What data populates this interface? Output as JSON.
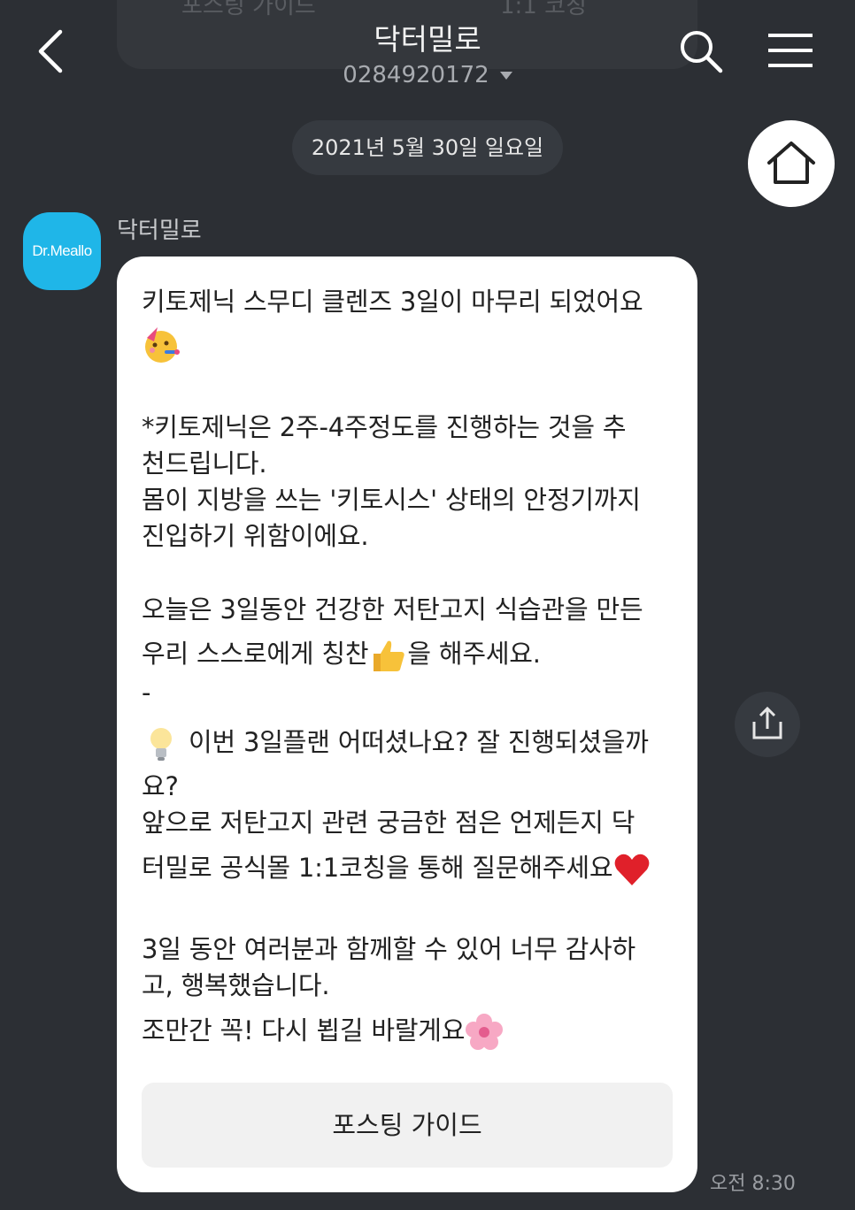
{
  "header": {
    "behind_tab_left": "포스팅 가이드",
    "behind_tab_right": "1:1 코칭",
    "title": "닥터밀로",
    "subtitle": "0284920172"
  },
  "date_divider": "2021년 5월 30일 일요일",
  "message": {
    "avatar_text": "Dr.Meallo",
    "sender": "닥터밀로",
    "lines": [
      "키토제닉 스무디 클렌즈 3일이 마무리 되었어요",
      "*키토제닉은 2주-4주정도를 진행하는 것을 추",
      "천드립니다.",
      "몸이 지방을 쓰는 '키토시스' 상태의 안정기까지",
      "진입하기 위함이에요.",
      "오늘은 3일동안 건강한 저탄고지 식습관을 만든",
      "우리  스스로에게 칭찬",
      "을 해주세요.",
      "-",
      "이번 3일플랜 어떠셨나요? 잘 진행되셨을까",
      "요?",
      "앞으로 저탄고지 관련 궁금한 점은 언제든지 닥",
      "터밀로 공식몰 1:1코칭을 통해 질문해주세요",
      "3일 동안 여러분과 함께할 수 있어 너무 감사하",
      "고, 행복했습니다.",
      "조만간 꼭! 다시 뵙길 바랄게요"
    ],
    "button_label": "포스팅 가이드",
    "time": "오전 8:30"
  },
  "icons": {
    "back": "back-arrow-icon",
    "search": "search-icon",
    "menu": "hamburger-menu-icon",
    "home": "home-icon",
    "share": "share-icon",
    "party": "partying-face-emoji",
    "thumbs": "thumbs-up-emoji",
    "bulb": "light-bulb-emoji",
    "heart": "red-heart-emoji",
    "flower": "cherry-blossom-emoji"
  },
  "colors": {
    "background": "#2c2f34",
    "bubble": "#ffffff",
    "avatar": "#1fb6e8"
  }
}
